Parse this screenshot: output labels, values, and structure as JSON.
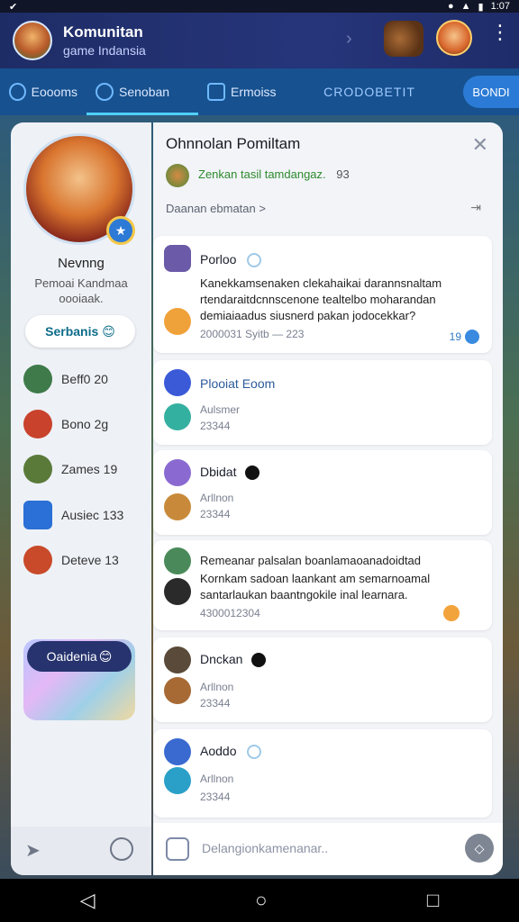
{
  "status": {
    "time": "1:07"
  },
  "header": {
    "title": "Komunitan",
    "subtitle": "game Indansia"
  },
  "tabs": [
    {
      "label": "Eoooms"
    },
    {
      "label": "Senoban"
    },
    {
      "label": "Ermoiss"
    },
    {
      "label": "CRODOBETIT"
    }
  ],
  "tab_button": "BONDI",
  "profile": {
    "name": "Nevnng",
    "subtitle": "Pemoai Kandmaa oooiaak.",
    "button": "Serbanis"
  },
  "sidebar_items": [
    {
      "label": "Beff0 20",
      "color": "#3e7a4a"
    },
    {
      "label": "Bono 2g",
      "color": "#c8422c"
    },
    {
      "label": "Zames 19",
      "color": "#5a7a3a"
    },
    {
      "label": "Ausiec 133",
      "color": "#2a70d6"
    },
    {
      "label": "Deteve 13",
      "color": "#c84a2a"
    }
  ],
  "promo": {
    "label": "Oaidenia"
  },
  "main": {
    "title": "Ohnnolan Pomiltam",
    "info": "Zenkan tasil tamdangaz.",
    "info_num": "93",
    "subtitle": "Daanan ebmatan >"
  },
  "posts": [
    {
      "title": "Porloo",
      "body": "Kanekkamsenaken clekahaikai darannsnaltam rtendaraitdcnnscenone tealtelbo moharandan demiaiaadus siusnerd pakan jodocekkar?",
      "meta": "2000031 Syitb — 223",
      "badge": "19",
      "av1": "#6a5aa8",
      "av2": "#f0a23a"
    },
    {
      "title": "Plooiat Eoom",
      "body": "",
      "meta_top": "Aulsmer",
      "meta": "23344",
      "av1": "#3a5ad8",
      "av2": "#34b0a0"
    },
    {
      "title": "Dbidat",
      "body": "",
      "meta_top": "Arllnon",
      "meta": "23344",
      "av1": "#8a6ad0",
      "av2": "#c88a3a"
    },
    {
      "title": "Remeanar palsalan boanlamaoanadoidtad",
      "body": "Kornkam sadoan laankant am semarnoamal santarlaukan baantngokile inal learnara.",
      "meta": "4300012304",
      "av1": "#4a8a5a",
      "av2": "#2a2a2a"
    },
    {
      "title": "Dnckan",
      "body": "",
      "meta_top": "Arllnon",
      "meta": "23344",
      "av1": "#5a4a3a",
      "av2": "#a86a35"
    },
    {
      "title": "Aoddo",
      "body": "",
      "meta_top": "Arllnon",
      "meta": "23344",
      "av1": "#3a6ad0",
      "av2": "#2aa0c8"
    }
  ],
  "composer": {
    "placeholder": "Delangionkamenanar.."
  }
}
